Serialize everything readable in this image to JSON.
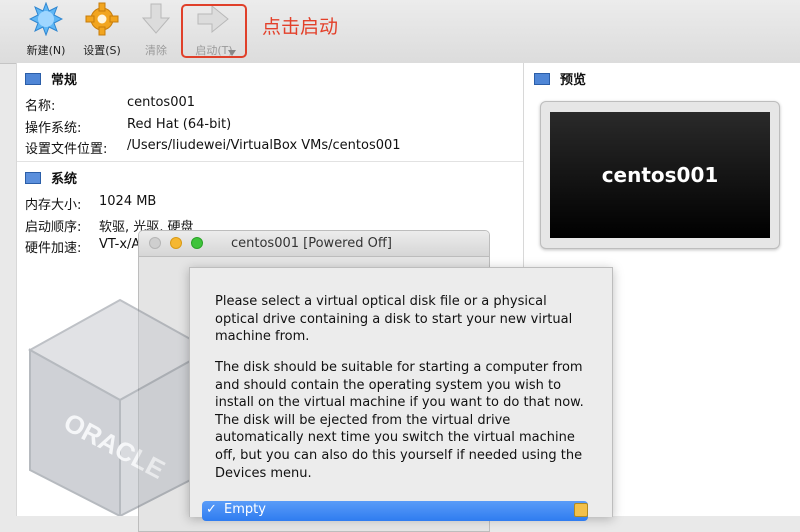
{
  "toolbar": {
    "new_label": "新建(N)",
    "settings_label": "设置(S)",
    "discard_label": "清除",
    "start_label": "启动(T)",
    "annotation": "点击启动",
    "highlight_color": "#e0402a"
  },
  "general": {
    "title": "常规",
    "rows": [
      {
        "key": "名称:",
        "value": "centos001"
      },
      {
        "key": "操作系统:",
        "value": "Red Hat (64-bit)"
      },
      {
        "key": "设置文件位置:",
        "value": "/Users/liudewei/VirtualBox VMs/centos001"
      }
    ]
  },
  "system": {
    "title": "系统",
    "rows": [
      {
        "key": "内存大小:",
        "value": "1024 MB"
      },
      {
        "key": "启动顺序:",
        "value": "软驱, 光驱, 硬盘"
      },
      {
        "key": "硬件加速:",
        "value": "VT-x/A"
      }
    ]
  },
  "preview": {
    "title": "预览",
    "screen_text": "centos001"
  },
  "vm_window": {
    "title": "centos001 [Powered Off]"
  },
  "dialog": {
    "paragraph1": "Please select a virtual optical disk file or a physical\noptical drive containing a disk to start your new virtual\nmachine from.",
    "paragraph2": "The disk should be suitable for starting a computer from\nand should contain the operating system you wish to\ninstall on the virtual machine if you want to do that now.\nThe disk will be ejected from the virtual drive\nautomatically next time you switch the virtual machine\noff, but you can also do this yourself if needed using the\nDevices menu.",
    "selected_disk": "Empty",
    "selected_check": "✓"
  },
  "watermark": {
    "logo_text": "ORACLE"
  }
}
